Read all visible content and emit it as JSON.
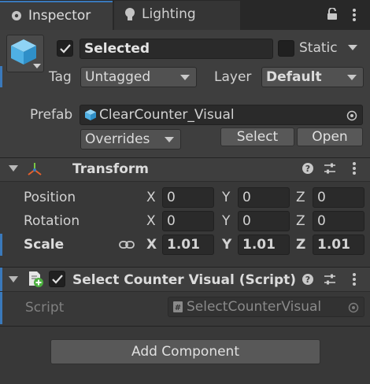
{
  "tabs": [
    {
      "label": "Inspector",
      "active": true
    },
    {
      "label": "Lighting",
      "active": false
    }
  ],
  "object": {
    "active": true,
    "name": "Selected",
    "static_label": "Static",
    "static": false,
    "tag_label": "Tag",
    "tag_value": "Untagged",
    "layer_label": "Layer",
    "layer_value": "Default"
  },
  "prefab": {
    "label": "Prefab",
    "asset": "ClearCounter_Visual",
    "overrides_label": "Overrides",
    "select_label": "Select",
    "open_label": "Open"
  },
  "transform": {
    "title": "Transform",
    "rows": [
      {
        "label": "Position",
        "x": "0",
        "y": "0",
        "z": "0"
      },
      {
        "label": "Rotation",
        "x": "0",
        "y": "0",
        "z": "0"
      },
      {
        "label": "Scale",
        "x": "1.01",
        "y": "1.01",
        "z": "1.01"
      }
    ],
    "axis_x": "X",
    "axis_y": "Y",
    "axis_z": "Z"
  },
  "script_component": {
    "title": "Select Counter Visual (Script)",
    "enabled": true,
    "script_label": "Script",
    "script_value": "SelectCounterVisual"
  },
  "add_component_label": "Add Component",
  "colors": {
    "panel_bg": "#383838",
    "header_bg": "#3e3e3e",
    "accent_blue": "#3a79bb",
    "prefab_cube": "#59b6e8"
  }
}
